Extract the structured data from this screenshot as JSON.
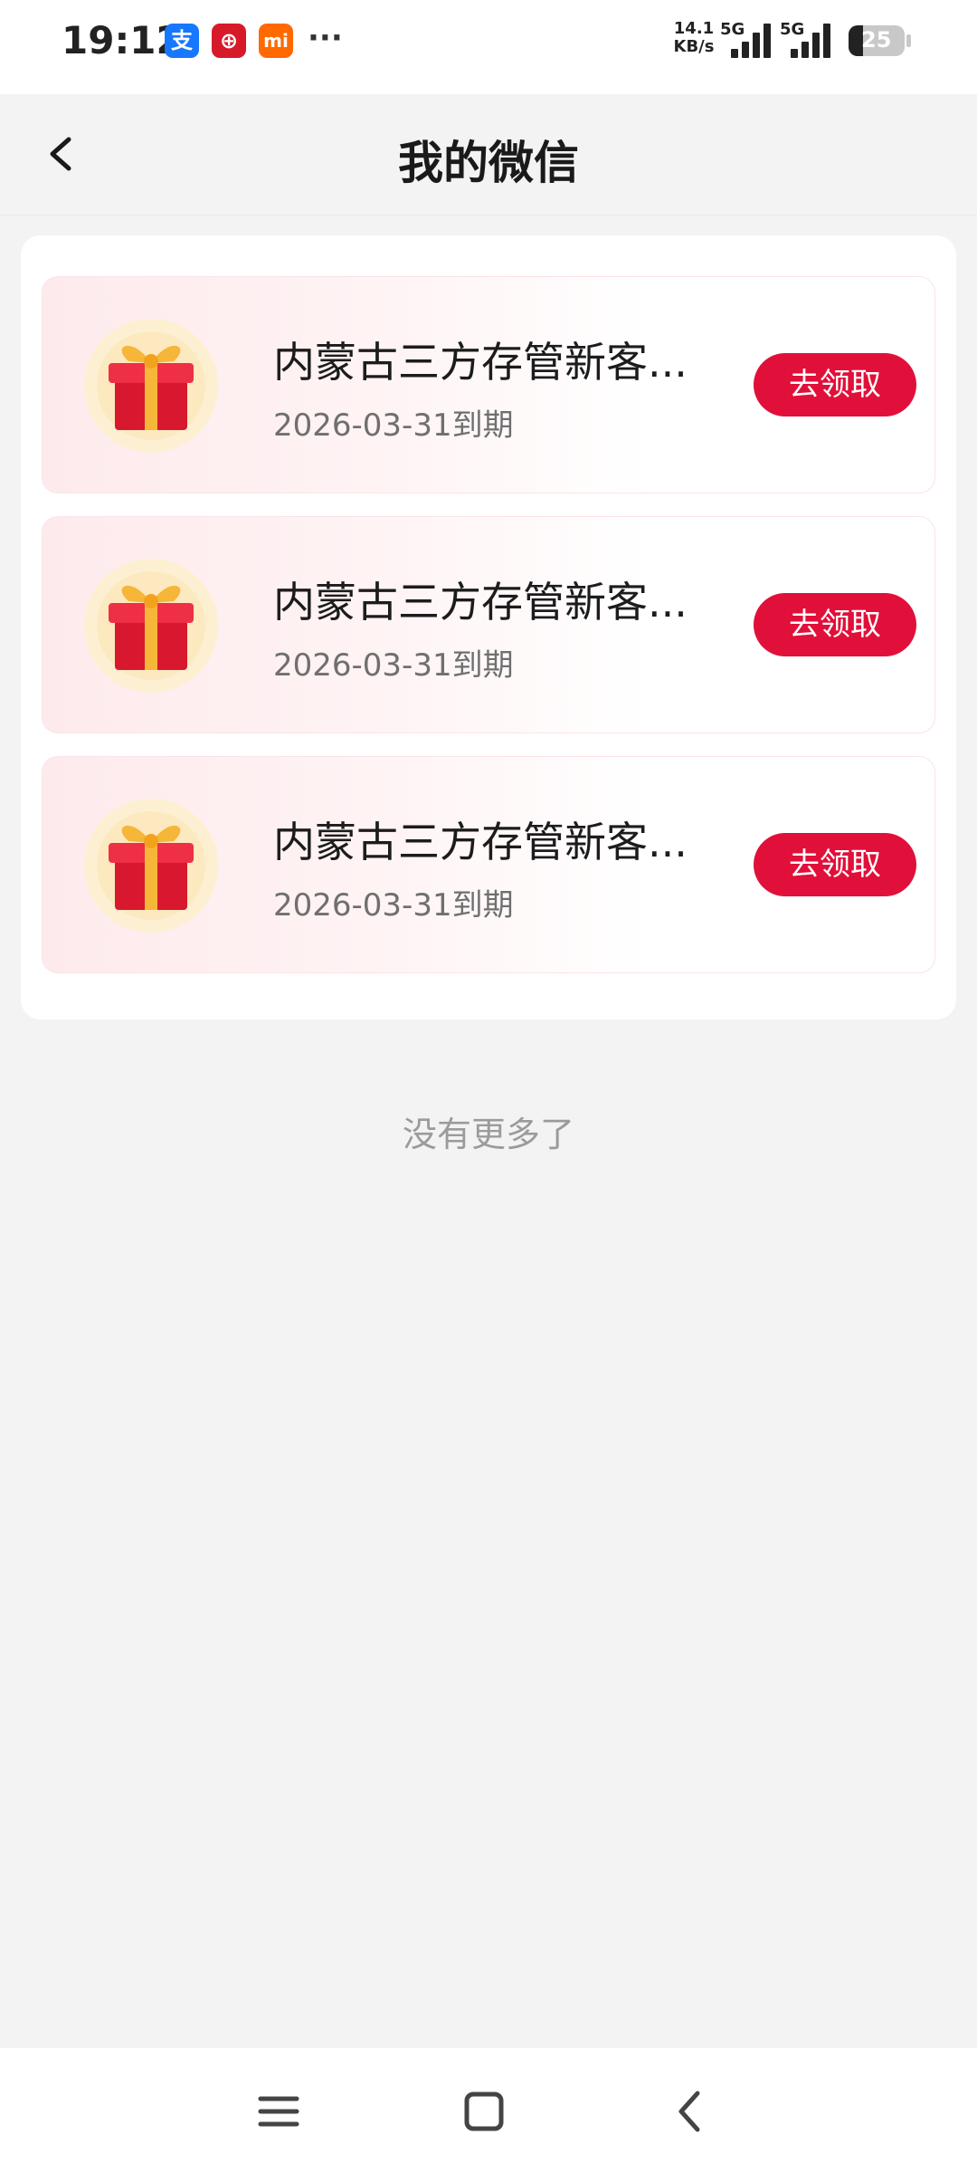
{
  "status_bar": {
    "time": "19:12",
    "app_icons": [
      {
        "name": "alipay-icon",
        "glyph": "支",
        "color": "#1677ff"
      },
      {
        "name": "bank-app-icon",
        "glyph": "⊕",
        "color": "#d71a2a"
      },
      {
        "name": "mi-icon",
        "glyph": "mi",
        "color": "#ff6900"
      }
    ],
    "more": "···",
    "net_speed": "14.1",
    "net_unit": "KB/s",
    "sim1_label": "5G",
    "sim2_label": "5G",
    "battery_level": "25",
    "battery_fraction": 0.25
  },
  "header": {
    "title": "我的微信",
    "back_icon": "chevron-left-icon"
  },
  "coupons": [
    {
      "title": "内蒙古三方存管新客...",
      "expiry": "2026-03-31到期",
      "button": "去领取"
    },
    {
      "title": "内蒙古三方存管新客...",
      "expiry": "2026-03-31到期",
      "button": "去领取"
    },
    {
      "title": "内蒙古三方存管新客...",
      "expiry": "2026-03-31到期",
      "button": "去领取"
    }
  ],
  "footer_text": "没有更多了",
  "bottom_nav": {
    "menu_icon": "menu-icon",
    "home_icon": "home-square-icon",
    "back_icon": "back-arrow-icon"
  },
  "colors": {
    "accent": "#e0103a",
    "background": "#f3f3f3",
    "card": "#ffffff"
  }
}
